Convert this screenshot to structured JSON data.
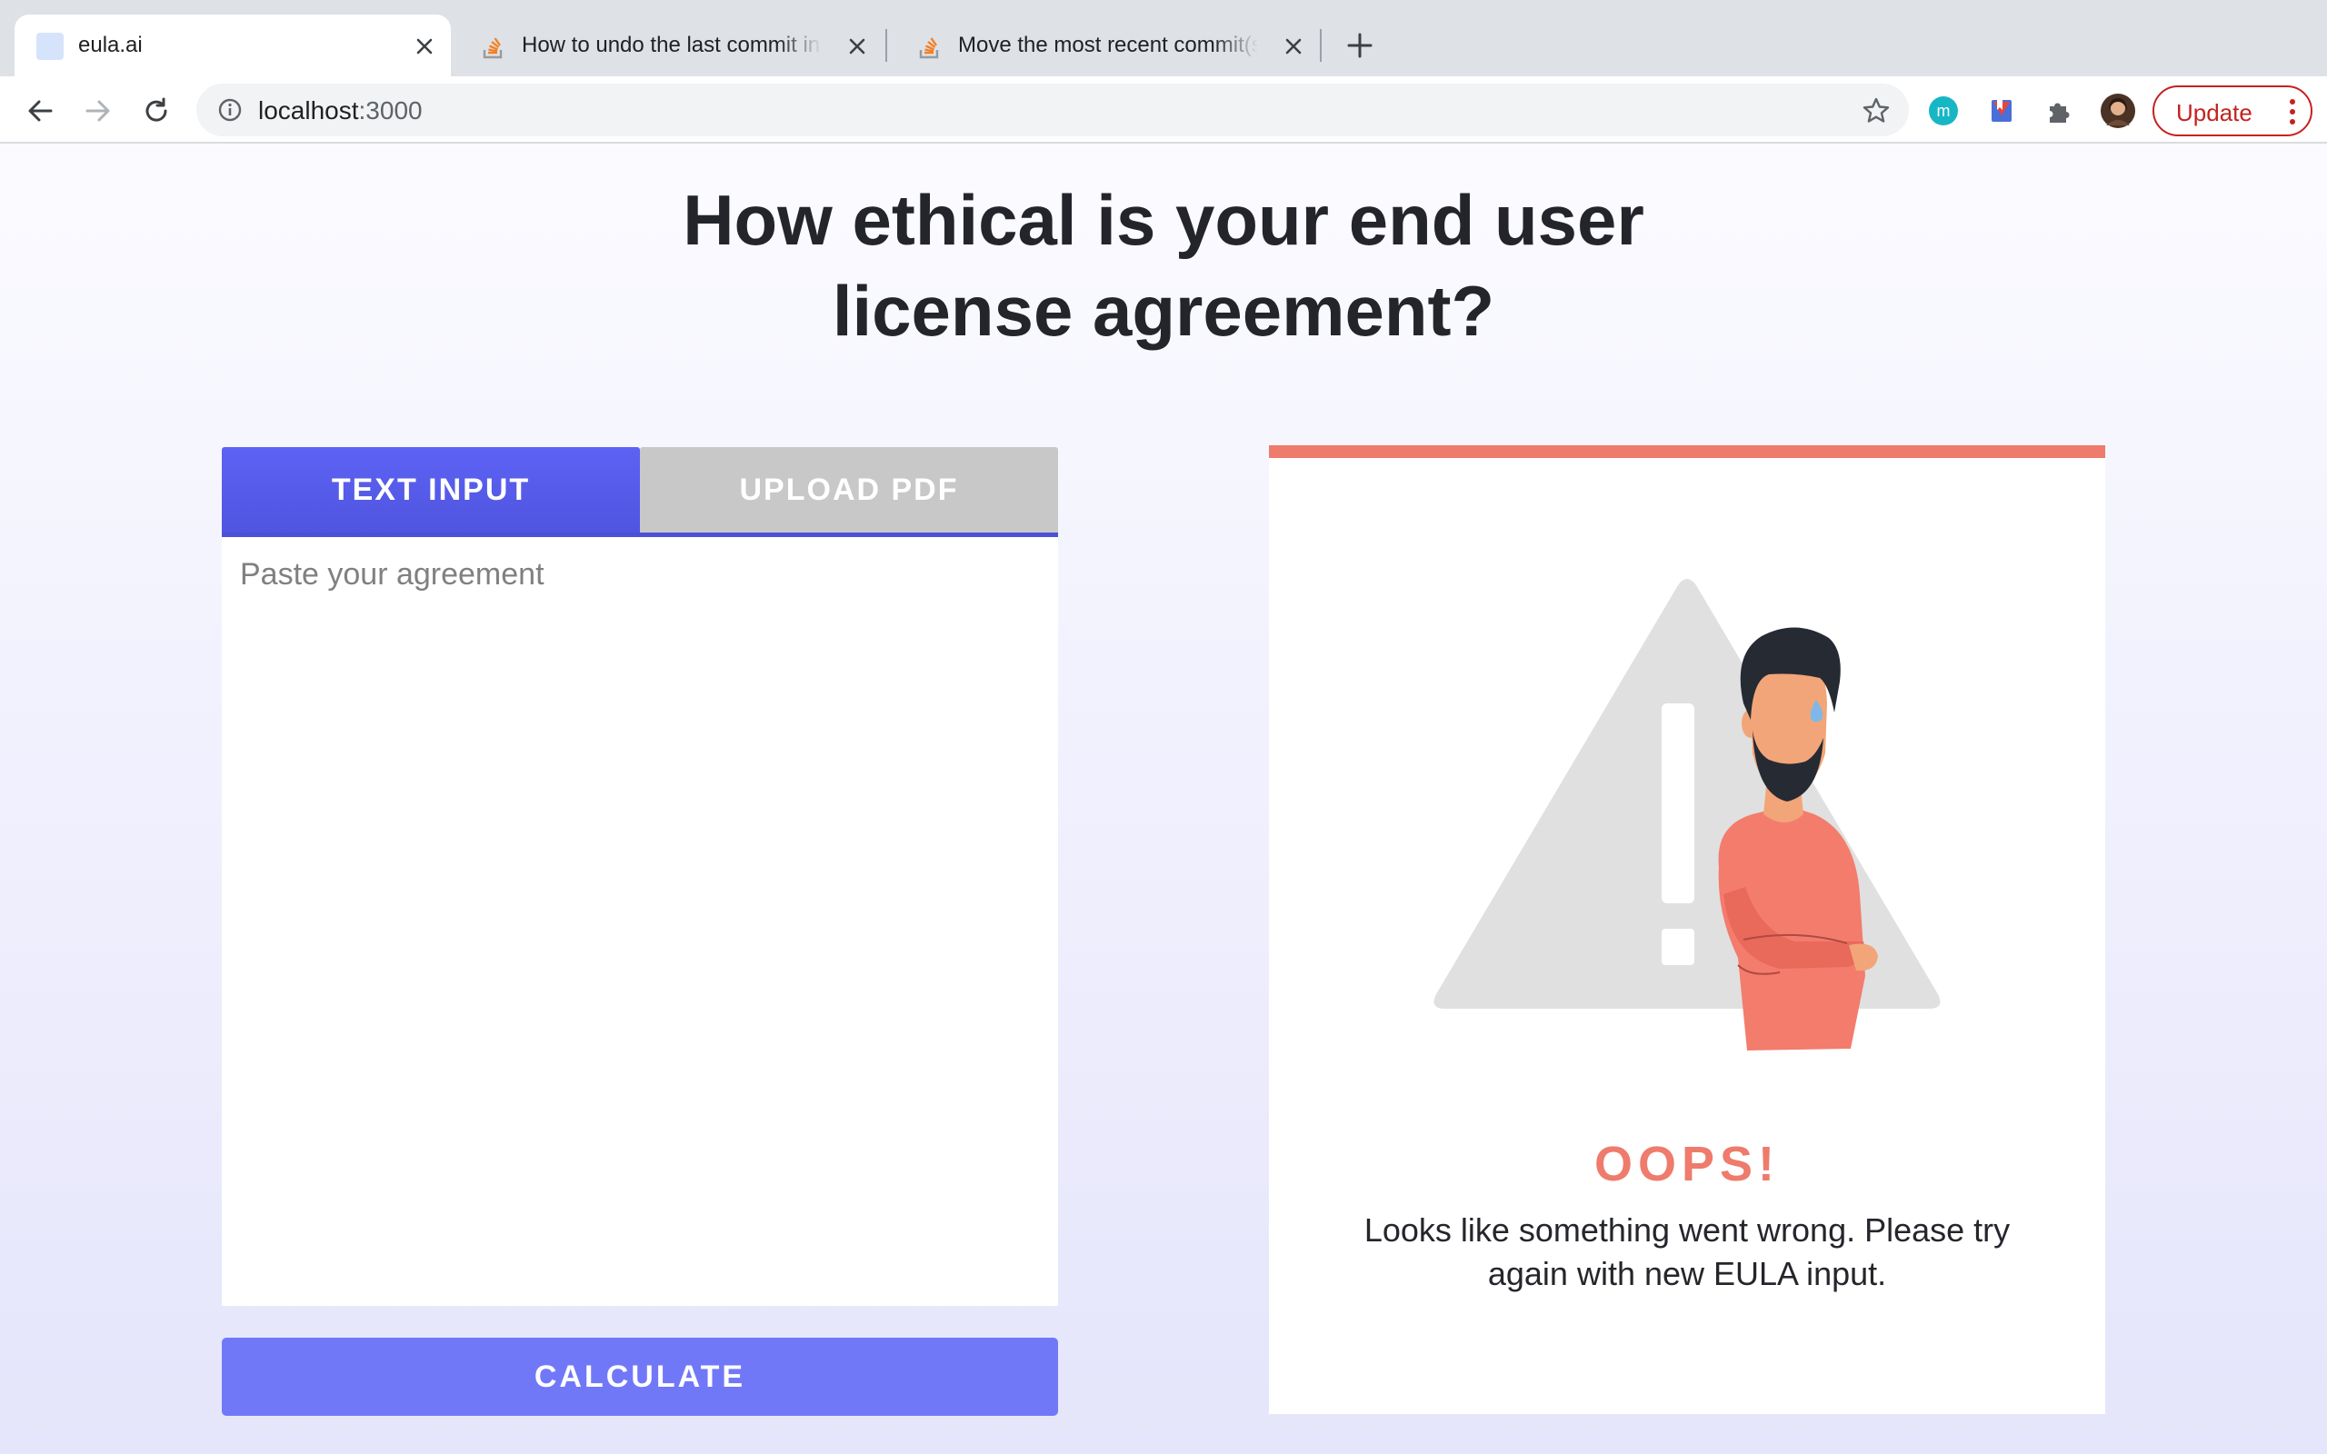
{
  "browser": {
    "tabs": [
      {
        "title": "eula.ai",
        "active": true,
        "favicon": "blank-page-icon"
      },
      {
        "title": "How to undo the last commit in Git",
        "active": false,
        "favicon": "stackoverflow-icon"
      },
      {
        "title": "Move the most recent commit(s) to a new branch",
        "active": false,
        "favicon": "stackoverflow-icon"
      }
    ],
    "url_host": "localhost",
    "url_port": ":3000",
    "update_label": "Update"
  },
  "page": {
    "headline_line1": "How ethical is your end user",
    "headline_line2": "license agreement?",
    "tabs": {
      "text_input": "TEXT INPUT",
      "upload_pdf": "UPLOAD PDF"
    },
    "textarea_placeholder": "Paste your agreement",
    "calculate_label": "CALCULATE",
    "result": {
      "title": "OOPS!",
      "message": "Looks like something went wrong. Please try again with new EULA input."
    }
  },
  "colors": {
    "accent": "#5d62f4",
    "button": "#7178f8",
    "error": "#ee7b6c",
    "inactive_tab": "#c8c8c8"
  }
}
